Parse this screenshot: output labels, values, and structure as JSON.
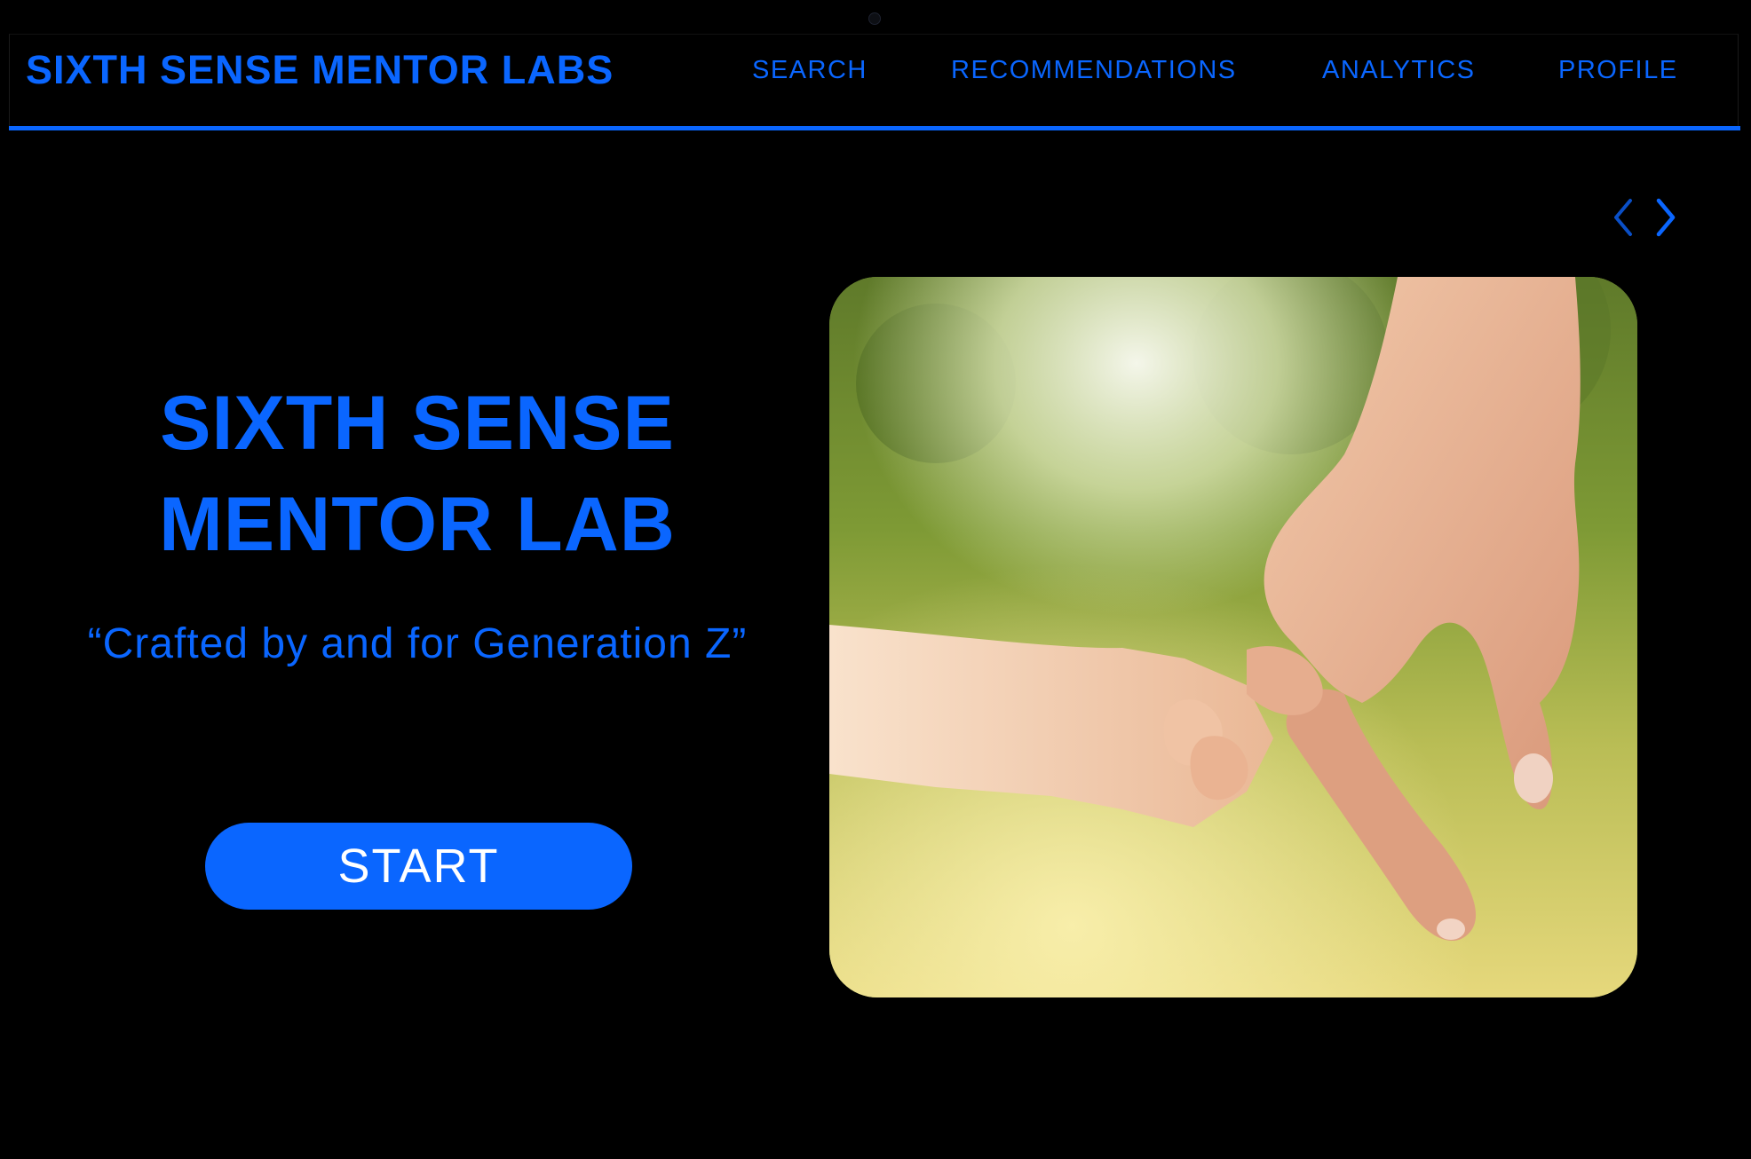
{
  "header": {
    "brand": "SIXTH SENSE MENTOR LABS",
    "nav": {
      "search": "SEARCH",
      "recommendations": "RECOMMENDATIONS",
      "analytics": "ANALYTICS",
      "profile": "PROFILE"
    }
  },
  "carousel": {
    "prev_icon": "chevron-left-icon",
    "next_icon": "chevron-right-icon"
  },
  "hero": {
    "title_line1": "SIXTH SENSE",
    "title_line2": "MENTOR LAB",
    "tagline": "“Crafted by and for Generation Z”",
    "start_label": "START",
    "image_subject": "adult hand holding child's hand in sunlit grass field"
  },
  "colors": {
    "background": "#000000",
    "accent": "#0a66ff",
    "button_text": "#ffffff"
  }
}
